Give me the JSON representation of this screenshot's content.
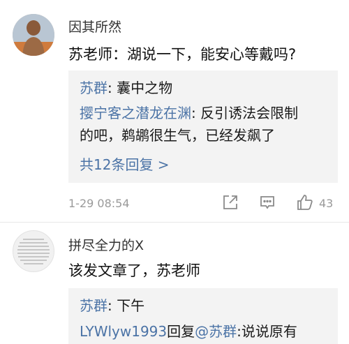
{
  "comment1": {
    "username": "因其所然",
    "text": "苏老师：湖说一下，能安心等戴吗?",
    "replies": [
      {
        "author": "苏群",
        "sep": ": ",
        "text": "囊中之物"
      },
      {
        "author": "撄宁客之潜龙在渊",
        "sep": ": ",
        "text": "反引诱法会限制",
        "text2": "的吧，鹈鹕很生气，已经发飙了"
      }
    ],
    "more_replies": "共12条回复 >",
    "timestamp": "1-29 08:54",
    "likes": "43"
  },
  "comment2": {
    "username": "拼尽全力的X",
    "text": "该发文章了，苏老师",
    "replies": [
      {
        "author": "苏群",
        "sep": ": ",
        "text": "下午"
      },
      {
        "author": "LYWlyw1993",
        "mid": "回复",
        "mention": "@苏群",
        "sep": ":",
        "text": "说说原有"
      }
    ]
  },
  "colors": {
    "link": "#4b73a6",
    "meta": "#9a9a9a",
    "reply_bg": "#f3f3f3"
  },
  "icons": [
    "share-icon",
    "comment-icon",
    "like-icon"
  ]
}
